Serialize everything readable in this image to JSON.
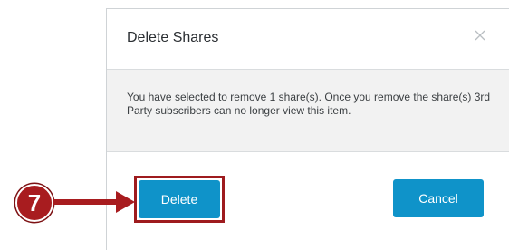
{
  "dialog": {
    "title": "Delete Shares",
    "close_icon": "close-icon",
    "message": "You have selected to remove 1 share(s). Once you remove the share(s) 3rd Party subscribers can no longer view this item.",
    "buttons": {
      "delete_label": "Delete",
      "cancel_label": "Cancel"
    }
  },
  "annotation": {
    "step_number": "7",
    "step_icon": "arrow-right-icon"
  },
  "colors": {
    "primary_button": "#0f93c9",
    "annotation_red": "#a81c1f",
    "body_background": "#f2f2f2"
  }
}
